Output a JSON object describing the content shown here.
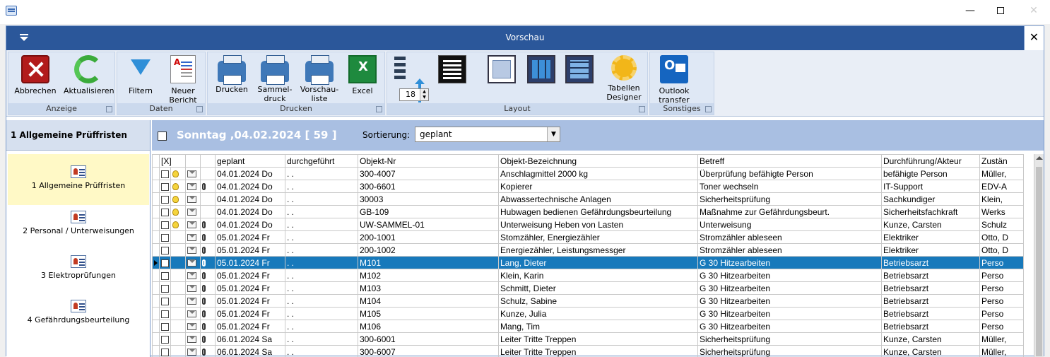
{
  "window": {
    "controls": {
      "minimize": "—",
      "close": "✕"
    }
  },
  "header": {
    "title": "Vorschau",
    "close": "✕"
  },
  "ribbon": {
    "groups": {
      "anzeige": "Anzeige",
      "daten": "Daten",
      "drucken": "Drucken",
      "layout": "Layout",
      "sonstiges": "Sonstiges"
    },
    "buttons": {
      "abbrechen": "Abbrechen",
      "aktualisieren": "Aktualisieren",
      "filtern": "Filtern",
      "neuer_bericht_1": "Neuer",
      "neuer_bericht_2": "Bericht",
      "drucken": "Drucken",
      "sammeldruck_1": "Sammel-",
      "sammeldruck_2": "druck",
      "vorschauliste_1": "Vorschau-",
      "vorschauliste_2": "liste",
      "excel": "Excel",
      "tabellen_designer_1": "Tabellen",
      "tabellen_designer_2": "Designer",
      "outlook_1": "Outlook",
      "outlook_2": "transfer"
    },
    "row_height": "18"
  },
  "left_pane": {
    "title": "1 Allgemeine Prüffristen",
    "items": [
      {
        "label": "1 Allgemeine Prüffristen",
        "selected": true
      },
      {
        "label": "2 Personal / Unterweisungen",
        "selected": false
      },
      {
        "label": "3 Elektroprüfungen",
        "selected": false
      },
      {
        "label": "4 Gefährdungsbeurteilung",
        "selected": false
      }
    ]
  },
  "date_bar": {
    "title": "Sonntag ,04.02.2024  [ 59 ]",
    "sort_label": "Sortierung:",
    "sort_value": "geplant"
  },
  "table": {
    "columns": [
      "[X]",
      "geplant",
      "durchgeführt",
      "Objekt-Nr",
      "Objekt-Bezeichnung",
      "Betreff",
      "Durchführung/Akteur",
      "Zustän"
    ],
    "rows": [
      {
        "bulb": true,
        "clip": false,
        "geplant": "04.01.2024 Do",
        "durchgefuehrt": ". .",
        "objekt_nr": "300-4007",
        "bezeichnung": "Anschlagmittel 2000 kg",
        "betreff": "Überprüfung befähigte Person",
        "akteur": "befähigte Person",
        "zustaendig": "Müller,"
      },
      {
        "bulb": true,
        "clip": true,
        "geplant": "04.01.2024 Do",
        "durchgefuehrt": ". .",
        "objekt_nr": "300-6601",
        "bezeichnung": "Kopierer",
        "betreff": "Toner wechseln",
        "akteur": "IT-Support",
        "zustaendig": "EDV-A"
      },
      {
        "bulb": true,
        "clip": false,
        "geplant": "04.01.2024 Do",
        "durchgefuehrt": ". .",
        "objekt_nr": "30003",
        "bezeichnung": "Abwassertechnische Anlagen",
        "betreff": "Sicherheitsprüfung",
        "akteur": "Sachkundiger",
        "zustaendig": "Klein,"
      },
      {
        "bulb": true,
        "clip": false,
        "geplant": "04.01.2024 Do",
        "durchgefuehrt": ". .",
        "objekt_nr": "GB-109",
        "bezeichnung": "Hubwagen bedienen Gefährdungsbeurteilung",
        "betreff": "Maßnahme zur Gefährdungsbeurt.",
        "akteur": "Sicherheitsfachkraft",
        "zustaendig": "Werks"
      },
      {
        "bulb": true,
        "clip": true,
        "geplant": "04.01.2024 Do",
        "durchgefuehrt": ". .",
        "objekt_nr": "UW-SAMMEL-01",
        "bezeichnung": "Unterweisung Heben von Lasten",
        "betreff": "Unterweisung",
        "akteur": "Kunze, Carsten",
        "zustaendig": "Schulz"
      },
      {
        "bulb": false,
        "clip": true,
        "geplant": "05.01.2024 Fr",
        "durchgefuehrt": ". .",
        "objekt_nr": "200-1001",
        "bezeichnung": "Stomzähler, Energiezähler",
        "betreff": "Stromzähler ableseen",
        "akteur": "Elektriker",
        "zustaendig": "Otto, D"
      },
      {
        "bulb": false,
        "clip": true,
        "geplant": "05.01.2024 Fr",
        "durchgefuehrt": ". .",
        "objekt_nr": "200-1002",
        "bezeichnung": "Energiezähler, Leistungsmessger",
        "betreff": "Stromzähler ableseen",
        "akteur": "Elektriker",
        "zustaendig": "Otto, D"
      },
      {
        "bulb": false,
        "clip": true,
        "selected": true,
        "geplant": "05.01.2024 Fr",
        "durchgefuehrt": ". .",
        "objekt_nr": "M101",
        "bezeichnung": "Lang, Dieter",
        "betreff": "G 30 Hitzearbeiten",
        "akteur": "Betriebsarzt",
        "zustaendig": "Perso"
      },
      {
        "bulb": false,
        "clip": true,
        "geplant": "05.01.2024 Fr",
        "durchgefuehrt": ". .",
        "objekt_nr": "M102",
        "bezeichnung": "Klein, Karin",
        "betreff": "G 30 Hitzearbeiten",
        "akteur": "Betriebsarzt",
        "zustaendig": "Perso"
      },
      {
        "bulb": false,
        "clip": true,
        "geplant": "05.01.2024 Fr",
        "durchgefuehrt": ". .",
        "objekt_nr": "M103",
        "bezeichnung": "Schmitt, Dieter",
        "betreff": "G 30 Hitzearbeiten",
        "akteur": "Betriebsarzt",
        "zustaendig": "Perso"
      },
      {
        "bulb": false,
        "clip": true,
        "geplant": "05.01.2024 Fr",
        "durchgefuehrt": ". .",
        "objekt_nr": "M104",
        "bezeichnung": "Schulz, Sabine",
        "betreff": "G 30 Hitzearbeiten",
        "akteur": "Betriebsarzt",
        "zustaendig": "Perso"
      },
      {
        "bulb": false,
        "clip": true,
        "geplant": "05.01.2024 Fr",
        "durchgefuehrt": ". .",
        "objekt_nr": "M105",
        "bezeichnung": "Kunze, Julia",
        "betreff": "G 30 Hitzearbeiten",
        "akteur": "Betriebsarzt",
        "zustaendig": "Perso"
      },
      {
        "bulb": false,
        "clip": true,
        "geplant": "05.01.2024 Fr",
        "durchgefuehrt": ". .",
        "objekt_nr": "M106",
        "bezeichnung": "Mang, Tim",
        "betreff": "G 30 Hitzearbeiten",
        "akteur": "Betriebsarzt",
        "zustaendig": "Perso"
      },
      {
        "bulb": false,
        "clip": true,
        "geplant": "06.01.2024 Sa",
        "durchgefuehrt": ". .",
        "objekt_nr": "300-6001",
        "bezeichnung": "Leiter Tritte Treppen",
        "betreff": "Sicherheitsprüfung",
        "akteur": "Kunze, Carsten",
        "zustaendig": "Müller,"
      },
      {
        "bulb": false,
        "clip": true,
        "geplant": "06.01.2024 Sa",
        "durchgefuehrt": ". .",
        "objekt_nr": "300-6007",
        "bezeichnung": "Leiter Tritte Treppen",
        "betreff": "Sicherheitsprüfung",
        "akteur": "Kunze, Carsten",
        "zustaendig": "Müller,"
      }
    ]
  },
  "colors": {
    "header_bg": "#2b579a",
    "selection": "#1779bb",
    "date_bar": "#a9bfe2",
    "nav_selected": "#fff9c6"
  }
}
